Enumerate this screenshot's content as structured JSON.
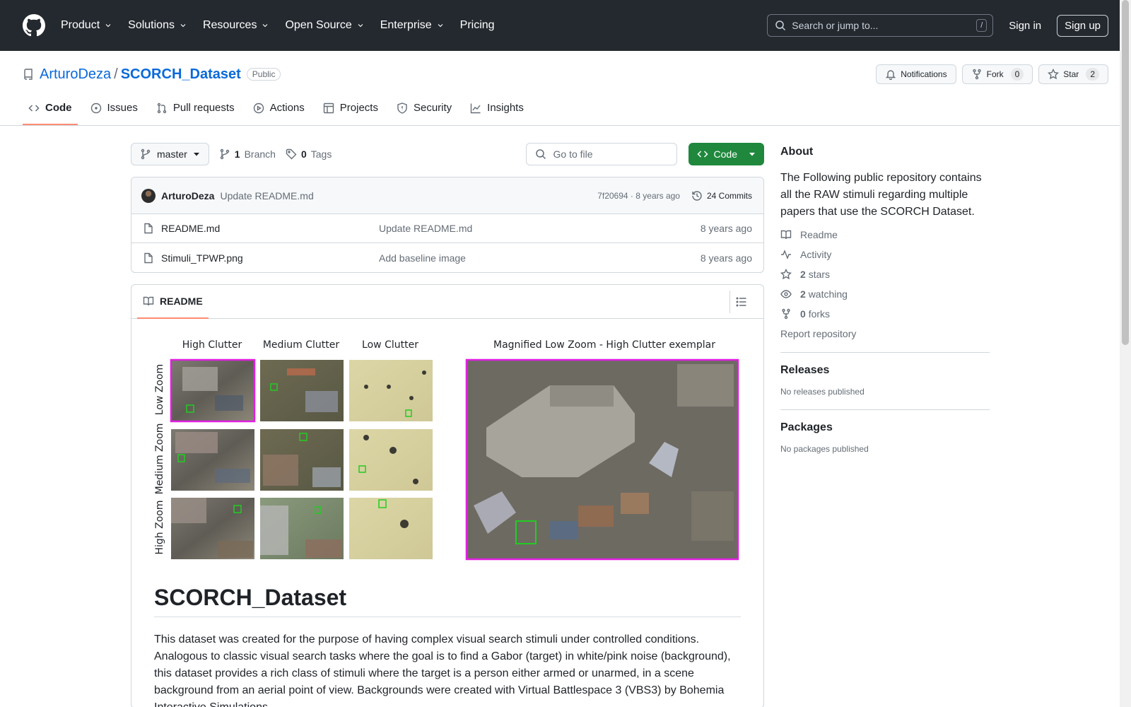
{
  "header": {
    "nav": [
      "Product",
      "Solutions",
      "Resources",
      "Open Source",
      "Enterprise",
      "Pricing"
    ],
    "search_placeholder": "Search or jump to...",
    "search_shortcut": "/",
    "sign_in": "Sign in",
    "sign_up": "Sign up"
  },
  "repo": {
    "owner": "ArturoDeza",
    "name": "SCORCH_Dataset",
    "visibility": "Public",
    "notifications_label": "Notifications",
    "fork_label": "Fork",
    "fork_count": "0",
    "star_label": "Star",
    "star_count": "2",
    "tabs": [
      "Code",
      "Issues",
      "Pull requests",
      "Actions",
      "Projects",
      "Security",
      "Insights"
    ]
  },
  "toolbar": {
    "branch": "master",
    "branch_count": "1",
    "branch_label": "Branch",
    "tag_count": "0",
    "tag_label": "Tags",
    "goto_placeholder": "Go to file",
    "code_label": "Code"
  },
  "commit": {
    "author": "ArturoDeza",
    "message": "Update README.md",
    "hash": "7f20694",
    "age": "8 years ago",
    "commits": "24 Commits"
  },
  "files": [
    {
      "name": "README.md",
      "message": "Update README.md",
      "age": "8 years ago"
    },
    {
      "name": "Stimuli_TPWP.png",
      "message": "Add baseline image",
      "age": "8 years ago"
    }
  ],
  "readme": {
    "tab_label": "README",
    "figure": {
      "col_labels": [
        "High Clutter",
        "Medium Clutter",
        "Low Clutter"
      ],
      "row_labels": [
        "Low Zoom",
        "Medium Zoom",
        "High Zoom"
      ],
      "magnified_label": "Magnified Low Zoom - High Clutter exemplar"
    },
    "title": "SCORCH_Dataset",
    "paragraph": "This dataset was created for the purpose of having complex visual search stimuli under controlled conditions. Analogous to classic visual search tasks where the goal is to find a Gabor (target) in white/pink noise (background), this dataset provides a rich class of stimuli where the target is a person either armed or unarmed, in a scene background from an aerial point of view. Backgrounds were created with Virtual Battlespace 3 (VBS3) by Bohemia Interactive Simulations."
  },
  "about": {
    "title": "About",
    "description": "The Following public repository contains all the RAW stimuli regarding multiple papers that use the SCORCH Dataset.",
    "readme": "Readme",
    "activity": "Activity",
    "stars_count": "2",
    "stars_label": "stars",
    "watching_count": "2",
    "watching_label": "watching",
    "forks_count": "0",
    "forks_label": "forks",
    "report": "Report repository"
  },
  "releases": {
    "title": "Releases",
    "empty": "No releases published"
  },
  "packages": {
    "title": "Packages",
    "empty": "No packages published"
  },
  "colors": {
    "accent_green": "#1f883d",
    "link_blue": "#0969da",
    "tab_underline": "#fd8c73",
    "header_bg": "#24292f"
  }
}
